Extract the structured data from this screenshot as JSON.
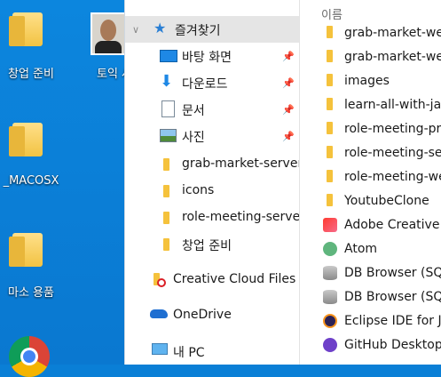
{
  "desktop": {
    "icons": [
      {
        "label": "창업 준비",
        "icon": "folder-icon"
      },
      {
        "label": "토익 사",
        "icon": "photo-icon"
      },
      {
        "label": "_MACOSX",
        "icon": "folder-icon"
      },
      {
        "label": "마소 용품",
        "icon": "folder-icon"
      },
      {
        "label": "",
        "icon": "chrome-icon"
      }
    ]
  },
  "nav": {
    "quick_access": "즐겨찾기",
    "items": [
      {
        "label": "바탕 화면",
        "icon": "desktop-icon",
        "pinned": true
      },
      {
        "label": "다운로드",
        "icon": "download-icon",
        "pinned": true
      },
      {
        "label": "문서",
        "icon": "document-icon",
        "pinned": true
      },
      {
        "label": "사진",
        "icon": "pictures-icon",
        "pinned": true
      },
      {
        "label": "grab-market-server",
        "icon": "folder-icon",
        "pinned": false
      },
      {
        "label": "icons",
        "icon": "folder-icon",
        "pinned": false
      },
      {
        "label": "role-meeting-server",
        "icon": "folder-icon",
        "pinned": false
      },
      {
        "label": "창업 준비",
        "icon": "folder-icon",
        "pinned": false
      }
    ],
    "creative_cloud": "Creative Cloud Files",
    "onedrive": "OneDrive",
    "this_pc": "내 PC"
  },
  "content": {
    "column_header": "이름",
    "items": [
      {
        "label": "grab-market-we",
        "icon": "folder-icon"
      },
      {
        "label": "grab-market-we",
        "icon": "folder-icon"
      },
      {
        "label": "images",
        "icon": "folder-icon"
      },
      {
        "label": "learn-all-with-jav",
        "icon": "folder-icon"
      },
      {
        "label": "role-meeting-pro",
        "icon": "folder-icon"
      },
      {
        "label": "role-meeting-ser",
        "icon": "folder-icon"
      },
      {
        "label": "role-meeting-we",
        "icon": "folder-icon"
      },
      {
        "label": "YoutubeClone",
        "icon": "folder-icon"
      },
      {
        "label": "Adobe Creative",
        "icon": "adobe-cc-icon"
      },
      {
        "label": "Atom",
        "icon": "atom-icon"
      },
      {
        "label": "DB Browser (SQL",
        "icon": "db-browser-icon"
      },
      {
        "label": "DB Browser (SQL",
        "icon": "db-browser-icon"
      },
      {
        "label": "Eclipse IDE for Ja",
        "icon": "eclipse-icon"
      },
      {
        "label": "GitHub Desktop",
        "icon": "github-desktop-icon"
      }
    ]
  },
  "colors": {
    "desktop_bg": "#0a7fd6",
    "selection": "#e5e5e5",
    "folder": "#f7c948",
    "quick_access_star": "#2a7fd4"
  }
}
